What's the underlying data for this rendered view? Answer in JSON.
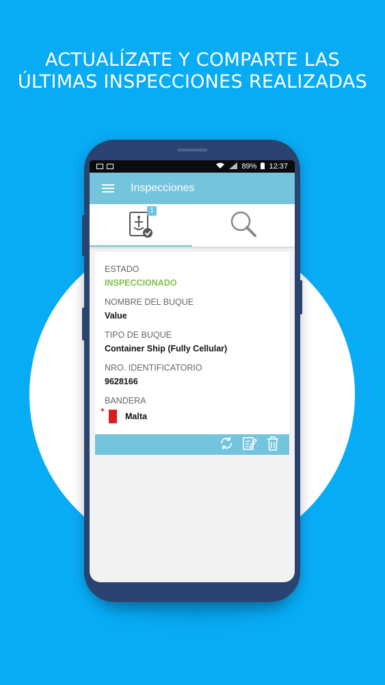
{
  "headline": {
    "line1": "ACTUALÍZATE Y COMPARTE LAS",
    "line2": "ÚLTIMAS INSPECCIONES REALIZADAS"
  },
  "statusbar": {
    "battery": "89%",
    "time": "12:37"
  },
  "appbar": {
    "title": "Inspecciones"
  },
  "tabs": {
    "inspections_badge": "1"
  },
  "card": {
    "estado_label": "ESTADO",
    "estado_value": "INSPECCIONADO",
    "nombre_label": "NOMBRE DEL BUQUE",
    "nombre_value": "Value",
    "tipo_label": "TIPO DE BUQUE",
    "tipo_value": "Container Ship (Fully Cellular)",
    "nro_label": "NRO. IDENTIFICATORIO",
    "nro_value": "9628166",
    "bandera_label": "BANDERA",
    "bandera_value": "Malta"
  },
  "colors": {
    "background": "#08acf5",
    "appbar": "#74c4dd",
    "status_green": "#7ec04f",
    "phone_frame": "#2b4370"
  }
}
